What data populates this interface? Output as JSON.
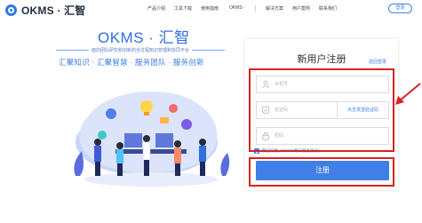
{
  "header": {
    "logo_text": "OKMS · 汇智",
    "nav": [
      "产品介绍",
      "工具下载",
      "使用指南",
      "OKMS ·",
      "解决方案",
      "用户案例",
      "联系我们"
    ],
    "login_label": "登录"
  },
  "hero": {
    "title": "OKMS · 汇智",
    "subtitle": "面向团队研究和创新的全过程知识管理和协同平台",
    "tags": "汇聚知识 · 汇聚智慧 · 服务团队 · 服务创新"
  },
  "register": {
    "title": "新用户注册",
    "back_login": "返回登录",
    "phone_placeholder": "手机号",
    "code_placeholder": "验证码",
    "send_code_label": "点击发送验证码",
    "password_placeholder": "密码",
    "agreement_text": "我已同意《OKMS用户服务协议》",
    "submit_label": "注册"
  },
  "colors": {
    "primary": "#3f7fe6",
    "annotation": "#d9231f"
  }
}
